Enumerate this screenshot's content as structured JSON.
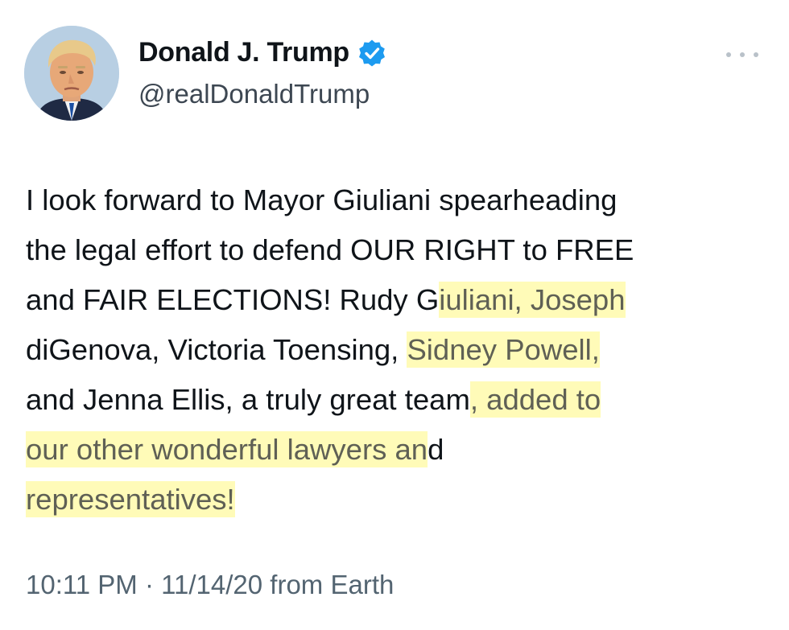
{
  "author": {
    "display_name": "Donald J. Trump",
    "handle": "@realDonaldTrump",
    "verified": true,
    "avatar_icon": "profile-photo",
    "verified_color": "#1d9bf0"
  },
  "menu": {
    "icon": "more-horizontal-icon"
  },
  "tweet": {
    "lines": [
      {
        "plain": "I look forward to Mayor Giuliani spearheading",
        "highlight": "",
        "tail": ""
      },
      {
        "plain": "the legal effort to defend OUR RIGHT to FREE",
        "highlight": "",
        "tail": ""
      },
      {
        "plain": "and FAIR ELECTIONS! Rudy G",
        "highlight": "iuliani, Joseph",
        "tail": ""
      },
      {
        "plain": "diGenova, Victoria Toensing, ",
        "highlight": "Sidney Powell,",
        "tail": ""
      },
      {
        "plain": "and Jenna Ellis, a truly great team",
        "highlight": ", added to",
        "tail": ""
      },
      {
        "plain": "",
        "highlight": "our other wonderful lawyers an",
        "tail": "d"
      },
      {
        "plain": "",
        "highlight": "representatives!",
        "tail": ""
      }
    ],
    "highlight_color": "#fff9a0"
  },
  "meta": {
    "timestamp": "10:11 PM · 11/14/20 from Earth"
  }
}
